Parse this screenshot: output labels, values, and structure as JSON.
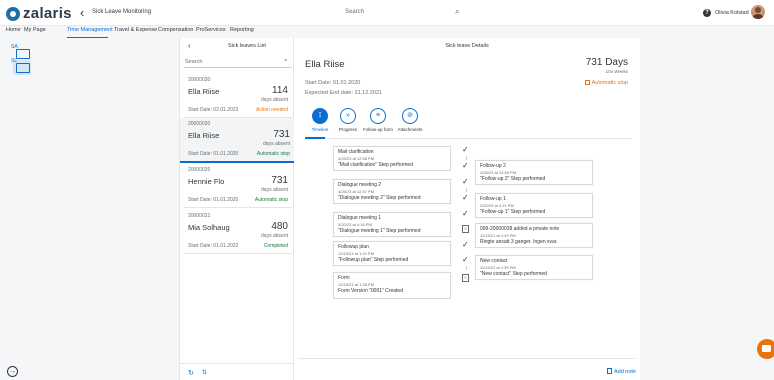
{
  "header": {
    "logo_text": "zalaris",
    "app_title": "Sick Leave Monitoring",
    "search_placeholder": "Search",
    "user_name": "Olivia Kolstad",
    "help_icon": "question-circle-icon",
    "search_icon": "search-icon"
  },
  "nav": {
    "items": [
      "Home",
      "My Page",
      "Time Management",
      "Travel & Expense",
      "Compensation",
      "ProServices",
      "Reporting"
    ],
    "active": "Time Management"
  },
  "rail": {
    "items": [
      {
        "label": "SA",
        "icon": "calendar-icon"
      },
      {
        "label": "SL",
        "icon": "sick-leave-icon"
      }
    ]
  },
  "list_panel": {
    "title": "Sick leaves List",
    "search_placeholder": "Search",
    "cards": [
      {
        "id": "20000030",
        "name": "Ella Riise",
        "days": "114",
        "unit": "days absent",
        "start": "Start Date: 02.01.2023",
        "status": "Action needed",
        "status_color": "#e9730c"
      },
      {
        "id": "20000030",
        "name": "Ella Riise",
        "days": "731",
        "unit": "days absent",
        "start": "Start Date: 01.01.2020",
        "status": "Automatic stop",
        "status_color": "#107e3e"
      },
      {
        "id": "20000026",
        "name": "Hennie Flo",
        "days": "731",
        "unit": "days absent",
        "start": "Start Date: 01.01.2020",
        "status": "Automatic stop",
        "status_color": "#107e3e"
      },
      {
        "id": "20000031",
        "name": "Mia Solhaug",
        "days": "480",
        "unit": "days absent",
        "start": "Start Date: 01.01.2022",
        "status": "Completed",
        "status_color": "#107e3e"
      }
    ]
  },
  "details": {
    "header": "Sick leave Details",
    "name": "Ella Riise",
    "days": "731 Days",
    "weeks": "104 Weeks",
    "start": "Start Date: 01.01.2020",
    "end": "Expected End date: 31.12.2021",
    "auto_stop": "Automatic stop",
    "tabs": [
      {
        "label": "Timeline",
        "icon": "timeline-icon"
      },
      {
        "label": "Progress",
        "icon": "progress-icon"
      },
      {
        "label": "Follow-up form",
        "icon": "form-icon"
      },
      {
        "label": "Attachments",
        "icon": "paperclip-icon"
      }
    ],
    "timeline_left": [
      {
        "title": "Mail clarification",
        "time": "4/25/23 at 12:58 PM",
        "desc": "\"Mail clarification\" Step performed"
      },
      {
        "title": "Dialogue meeting 2",
        "time": "4/25/23 at 12:57 PM",
        "desc": "\"Dialogue meeting 2\" Step performed"
      },
      {
        "title": "Dialogue meeting 1",
        "time": "2/20/23 at 4:16 PM",
        "desc": "\"Dialogue meeting 1\" Step performed"
      },
      {
        "title": "Followup plan",
        "time": "12/15/21 at 1:41 PM",
        "desc": "\"Followup plan\" Step performed"
      },
      {
        "title": "Form",
        "time": "12/15/21 at 1:28 PM",
        "desc": "Form Version \"0001\" Created"
      }
    ],
    "timeline_right": [
      {
        "title": "Follow-up 2",
        "time": "4/25/23 at 12:56 PM",
        "desc": "\"Follow-up 2\" Step performed"
      },
      {
        "title": "Follow-up 1",
        "time": "2/20/23 at 4:21 PM",
        "desc": "\"Follow-up 1\" Step performed"
      },
      {
        "title": "099-20000028 added a private note",
        "time": "11/15/21 at 1:43 PM",
        "desc": "Ringte ansatt 3 ganger. Ingen svar."
      },
      {
        "title": "New contact",
        "time": "11/15/21 at 1:35 PM",
        "desc": "\"New contact\" Step performed"
      }
    ],
    "add_note": "Add note"
  }
}
